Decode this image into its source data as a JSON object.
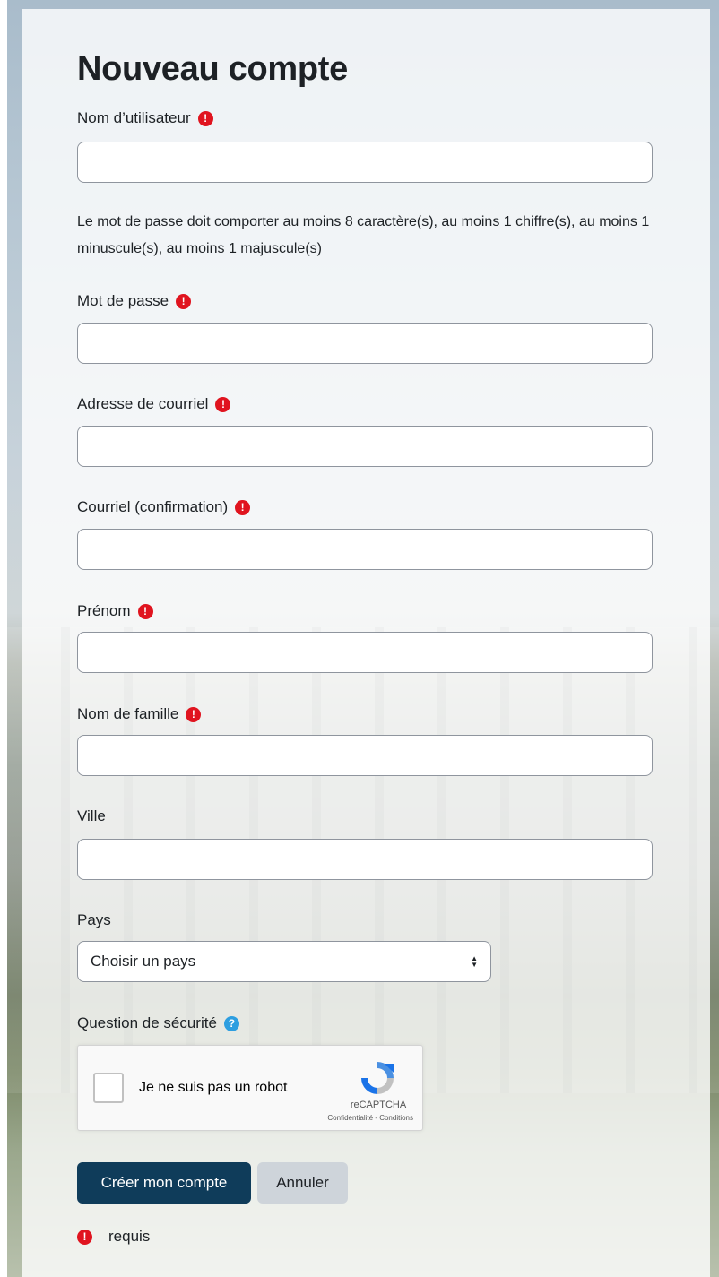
{
  "page": {
    "title": "Nouveau compte"
  },
  "fields": {
    "username": {
      "label": "Nom d’utilisateur",
      "value": ""
    },
    "password_hint": "Le mot de passe doit comporter au moins 8 caractère(s), au moins 1 chiffre(s), au moins 1 minuscule(s), au moins 1 majuscule(s)",
    "password": {
      "label": "Mot de passe",
      "value": ""
    },
    "email": {
      "label": "Adresse de courriel",
      "value": ""
    },
    "email_confirm": {
      "label": "Courriel (confirmation)",
      "value": ""
    },
    "firstname": {
      "label": "Prénom",
      "value": ""
    },
    "lastname": {
      "label": "Nom de famille",
      "value": ""
    },
    "city": {
      "label": "Ville",
      "value": ""
    },
    "country": {
      "label": "Pays",
      "selected": "Choisir un pays"
    },
    "security": {
      "label": "Question de sécurité"
    }
  },
  "recaptcha": {
    "label": "Je ne suis pas un robot",
    "brand": "reCAPTCHA",
    "terms": "Confidentialité - Conditions",
    "checked": false
  },
  "buttons": {
    "submit": "Créer mon compte",
    "cancel": "Annuler"
  },
  "legend": {
    "required": "requis"
  },
  "icons": {
    "required": "exclamation-circle-icon",
    "help": "question-circle-icon"
  },
  "colors": {
    "required": "#e0141f",
    "help": "#2d9ee0",
    "primary_button": "#0f3c5a",
    "secondary_button": "#ced4da"
  }
}
